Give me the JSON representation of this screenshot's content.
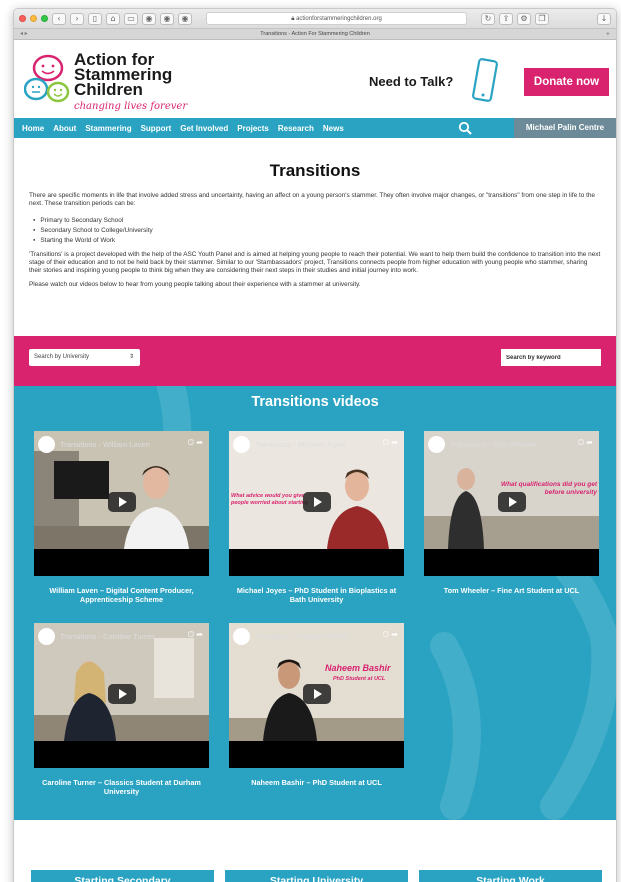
{
  "browser": {
    "url": "actionforstammeringchildren.org",
    "tab_title": "Transitions - Action For Stammering Children"
  },
  "header": {
    "logo_lines": [
      "Action for",
      "Stammering",
      "Children"
    ],
    "tagline": "changing lives forever",
    "need_to_talk": "Need to Talk?",
    "donate_label": "Donate now"
  },
  "nav": {
    "items": [
      "Home",
      "About",
      "Stammering",
      "Support",
      "Get Involved",
      "Projects",
      "Research",
      "News"
    ],
    "centre": "Michael Palin Centre"
  },
  "intro": {
    "title": "Transitions",
    "p1": "There are specific moments in life that involve added stress and uncertainty, having an affect on a young person's stammer. They often involve major changes, or \"transitions\" from one step in life to the next. These transition periods can be:",
    "list": [
      "Primary to Secondary School",
      "Secondary School to College/University",
      "Starting the World of Work"
    ],
    "p2": "'Transitions' is a project developed with the help of the ASC Youth Panel and is aimed at helping young people to reach their potential. We want to help them build the confidence to transition into the next stage of their education and to not be held back by their stammer. Similar to our 'Stambassadors' project, Transitions connects people from higher education with young people who stammer, sharing their stories and inspiring young people to think big when they are considering their next steps in their studies and initial journey into work.",
    "p3": "Please watch our videos below to hear from young people talking about their experience with a stammer at university."
  },
  "filters": {
    "university_select": "Search by University",
    "keyword_placeholder": "Search by keyword"
  },
  "videos": {
    "title": "Transitions videos",
    "items": [
      {
        "thumb_title": "Transitions - William Laven",
        "caption": "William Laven – Digital Content Producer, Apprenticeship Scheme",
        "overlay": ""
      },
      {
        "thumb_title": "Transitions - Michael Joyes",
        "caption": "Michael Joyes – PhD Student in Bioplastics at Bath University",
        "overlay": "What advice would you give people worried about starting"
      },
      {
        "thumb_title": "Transitions - Tom Wheeler",
        "caption": "Tom Wheeler – Fine Art Student at UCL",
        "overlay": "What qualifications did you get before university"
      },
      {
        "thumb_title": "Transitions - Caroline Turner",
        "caption": "Caroline Turner – Classics Student at Durham University",
        "overlay": ""
      },
      {
        "thumb_title": "Transitions - Naheem Bashir",
        "caption": "Naheem Bashir – PhD Student at UCL",
        "overlay": "Naheem Bashir",
        "overlay_sub": "PhD Student at UCL"
      }
    ]
  },
  "bottom_buttons": [
    "Starting Secondary",
    "Starting University",
    "Starting Work"
  ],
  "colors": {
    "brand_pink": "#d9236e",
    "brand_blue": "#2aa3c2",
    "nav_grey": "#6c8a97"
  },
  "icons": {
    "search": "search-icon",
    "phone": "phone-icon",
    "play": "play-icon"
  }
}
